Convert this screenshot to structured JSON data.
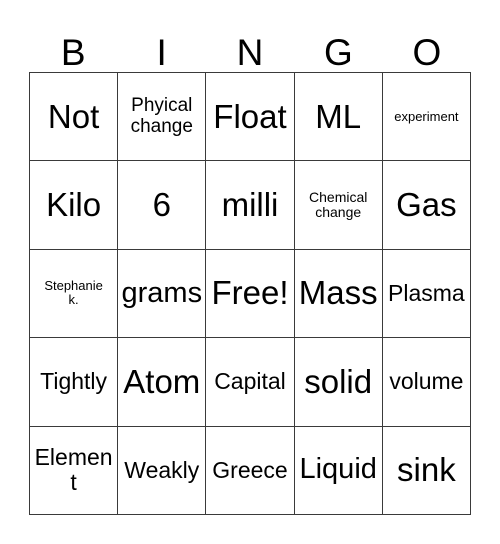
{
  "card": {
    "title": "BINGO",
    "header_letters": [
      "B",
      "I",
      "N",
      "G",
      "O"
    ],
    "rows": [
      [
        {
          "text": "Not",
          "size": "fs-xl"
        },
        {
          "text": "Phyical\nchange",
          "size": "fs-sm"
        },
        {
          "text": "Float",
          "size": "fs-xl"
        },
        {
          "text": "ML",
          "size": "fs-xl"
        },
        {
          "text": "experiment",
          "size": "fs-xxs"
        }
      ],
      [
        {
          "text": "Kilo",
          "size": "fs-xl"
        },
        {
          "text": "6",
          "size": "fs-xl"
        },
        {
          "text": "milli",
          "size": "fs-xl"
        },
        {
          "text": "Chemical\nchange",
          "size": "fs-xs"
        },
        {
          "text": "Gas",
          "size": "fs-xl"
        }
      ],
      [
        {
          "text": "Stephanie\nk.",
          "size": "fs-xxs"
        },
        {
          "text": "grams",
          "size": "fs-lg"
        },
        {
          "text": "Free!",
          "size": "fs-xl"
        },
        {
          "text": "Mass",
          "size": "fs-xl"
        },
        {
          "text": "Plasma",
          "size": "fs-md"
        }
      ],
      [
        {
          "text": "Tightly",
          "size": "fs-md"
        },
        {
          "text": "Atom",
          "size": "fs-xl"
        },
        {
          "text": "Capital",
          "size": "fs-md"
        },
        {
          "text": "solid",
          "size": "fs-xl"
        },
        {
          "text": "volume",
          "size": "fs-md"
        }
      ],
      [
        {
          "text": "Element",
          "size": "fs-md"
        },
        {
          "text": "Weakly",
          "size": "fs-md"
        },
        {
          "text": "Greece",
          "size": "fs-md"
        },
        {
          "text": "Liquid",
          "size": "fs-lg"
        },
        {
          "text": "sink",
          "size": "fs-xl"
        }
      ]
    ],
    "free_space_label": "Free!",
    "colors": {
      "background": "#ffffff",
      "text": "#000000",
      "grid_line": "#3a3a3a"
    }
  }
}
